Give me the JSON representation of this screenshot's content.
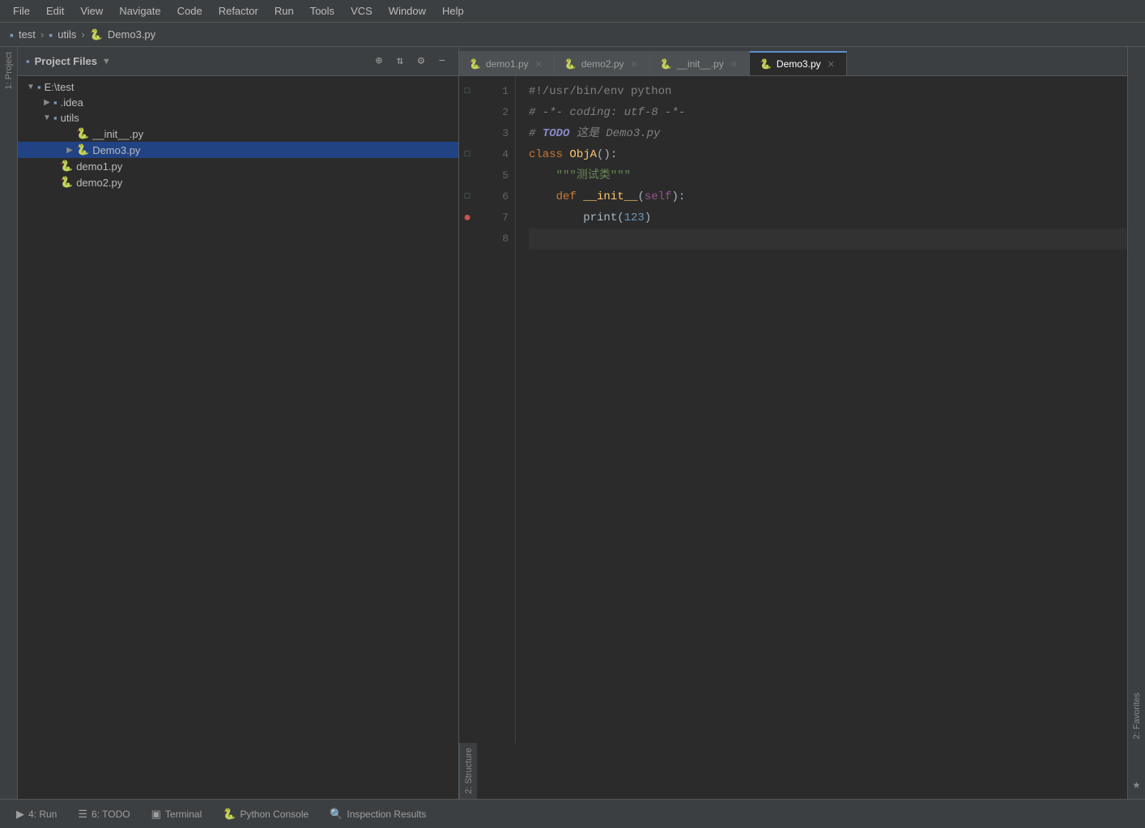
{
  "menu": {
    "items": [
      "File",
      "Edit",
      "View",
      "Navigate",
      "Code",
      "Refactor",
      "Run",
      "Tools",
      "VCS",
      "Window",
      "Help"
    ]
  },
  "titlebar": {
    "folder": "test",
    "subfolder": "utils",
    "file": "Demo3.py"
  },
  "project_panel": {
    "title": "Project Files",
    "dropdown_arrow": "▼"
  },
  "tree": {
    "items": [
      {
        "indent": 0,
        "arrow": "▼",
        "type": "folder",
        "label": "E:\\test",
        "selected": false
      },
      {
        "indent": 1,
        "arrow": "▶",
        "type": "folder",
        "label": ".idea",
        "selected": false
      },
      {
        "indent": 1,
        "arrow": "▼",
        "type": "folder",
        "label": "utils",
        "selected": false
      },
      {
        "indent": 2,
        "arrow": "",
        "type": "py",
        "label": "__init__.py",
        "selected": false
      },
      {
        "indent": 2,
        "arrow": "▶",
        "type": "py",
        "label": "Demo3.py",
        "selected": true
      },
      {
        "indent": 1,
        "arrow": "",
        "type": "py",
        "label": "demo1.py",
        "selected": false
      },
      {
        "indent": 1,
        "arrow": "",
        "type": "py",
        "label": "demo2.py",
        "selected": false
      }
    ]
  },
  "tabs": [
    {
      "label": "demo1.py",
      "active": false
    },
    {
      "label": "demo2.py",
      "active": false
    },
    {
      "label": "__init__.py",
      "active": false
    },
    {
      "label": "Demo3.py",
      "active": true
    }
  ],
  "code": {
    "lines": [
      {
        "num": 1,
        "gutter": "shebang",
        "content": "#!/usr/bin/env python",
        "type": "comment"
      },
      {
        "num": 2,
        "gutter": "",
        "content": "# -*- coding: utf-8 -*-",
        "type": "comment"
      },
      {
        "num": 3,
        "gutter": "todo",
        "content": "# TODO 这是 Demo3.py",
        "type": "todo"
      },
      {
        "num": 4,
        "gutter": "class",
        "content": "class ObjA():",
        "type": "class"
      },
      {
        "num": 5,
        "gutter": "",
        "content": "    \"\"\"测试类\"\"\"",
        "type": "string"
      },
      {
        "num": 6,
        "gutter": "def",
        "content": "    def __init__(self):",
        "type": "def"
      },
      {
        "num": 7,
        "gutter": "bp",
        "content": "        print(123)",
        "type": "print"
      },
      {
        "num": 8,
        "gutter": "",
        "content": "",
        "type": "empty",
        "current": true
      }
    ]
  },
  "bottom_tabs": [
    {
      "icon": "▶",
      "label": "4: Run"
    },
    {
      "icon": "☰",
      "label": "6: TODO"
    },
    {
      "icon": "▣",
      "label": "Terminal"
    },
    {
      "icon": "🐍",
      "label": "Python Console"
    },
    {
      "icon": "🔍",
      "label": "Inspection Results"
    }
  ],
  "side_labels": {
    "project": "1: Project",
    "structure": "2: Structure",
    "favorites": "2: Favorites"
  }
}
